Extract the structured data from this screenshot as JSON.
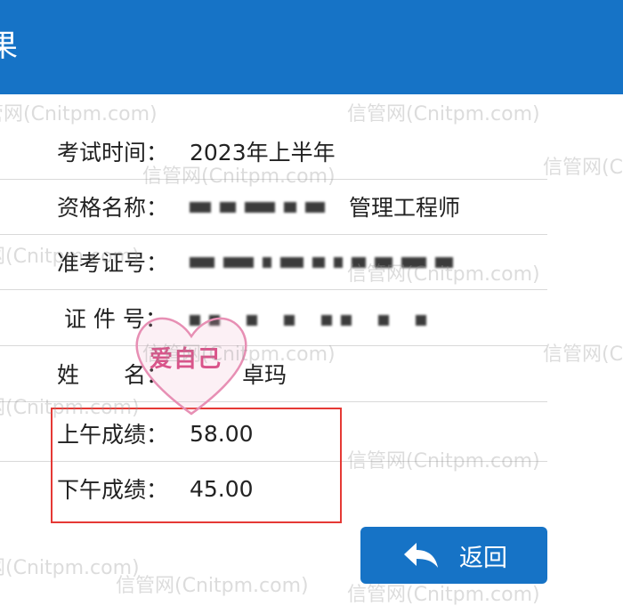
{
  "header": {
    "title": "果"
  },
  "rows": [
    {
      "label": "考试时间：",
      "value": "2023年上半年"
    },
    {
      "label": "资格名称：",
      "value": "管理工程师"
    },
    {
      "label": "准考证号：",
      "value": ""
    },
    {
      "label": " 证 件 号：",
      "value": ""
    },
    {
      "label": "姓　　名：",
      "value": "卓玛"
    },
    {
      "label": "上午成绩：",
      "value": "58.00"
    },
    {
      "label": "下午成绩：",
      "value": "45.00"
    }
  ],
  "stamp": {
    "text": "爱自己"
  },
  "back_button": {
    "label": "返回",
    "icon": "back-arrow-icon"
  },
  "watermark": {
    "text": "信管网(Cnitpm.com)"
  },
  "colors": {
    "header": "#1673c6",
    "highlight": "#e53935",
    "button": "#1673c6"
  }
}
